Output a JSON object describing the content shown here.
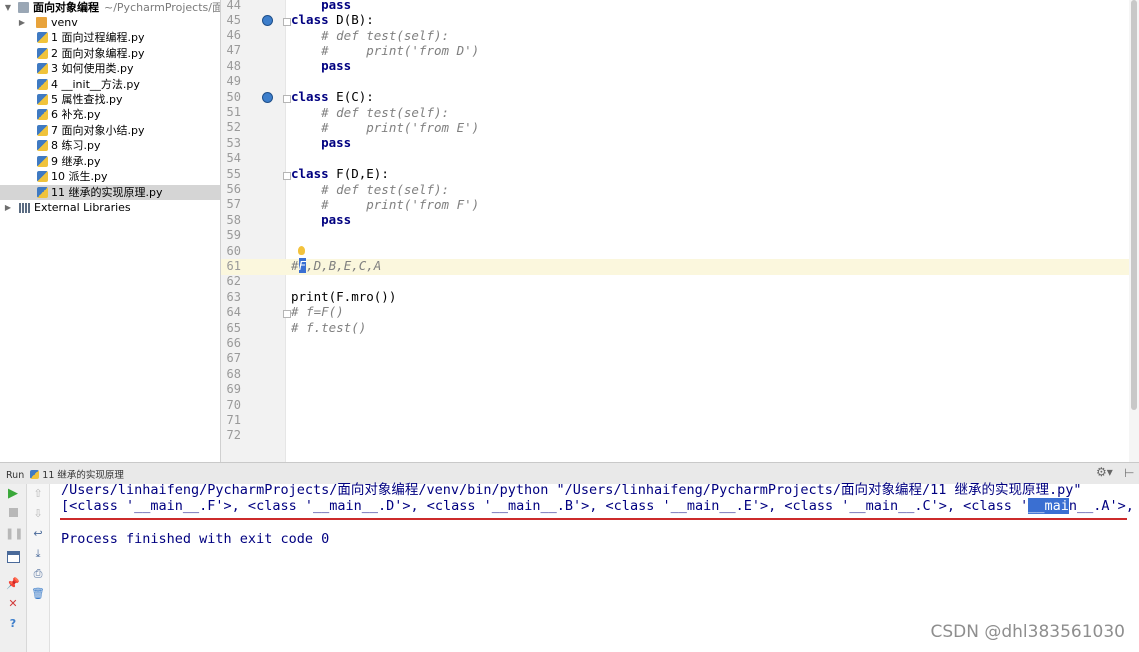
{
  "project": {
    "root_name": "面向对象编程",
    "root_path": "~/PycharmProjects/面向",
    "venv": "venv",
    "files": [
      "1 面向过程编程.py",
      "2 面向对象编程.py",
      "3 如何使用类.py",
      "4 __init__方法.py",
      "5 属性查找.py",
      "6 补充.py",
      "7 面向对象小结.py",
      "8 练习.py",
      "9 继承.py",
      "10 派生.py",
      "11 继承的实现原理.py"
    ],
    "selected_file_index": 10,
    "external_libraries": "External Libraries"
  },
  "editor": {
    "line_numbers": [
      "44",
      "45",
      "46",
      "47",
      "48",
      "49",
      "50",
      "51",
      "52",
      "53",
      "54",
      "55",
      "56",
      "57",
      "58",
      "59",
      "60",
      "61",
      "62",
      "63",
      "64",
      "65",
      "66",
      "67",
      "68",
      "69",
      "70",
      "71",
      "72"
    ],
    "code": {
      "l44": "    pass",
      "l45_kw": "class",
      "l45_rest": " D(B):",
      "l46": "    # def test(self):",
      "l47": "    #     print('from D')",
      "l48": "    pass",
      "l50_kw": "class",
      "l50_rest": " E(C):",
      "l51": "    # def test(self):",
      "l52": "    #     print('from E')",
      "l53": "    pass",
      "l55_kw": "class",
      "l55_rest": " F(D,E):",
      "l56": "    # def test(self):",
      "l57": "    #     print('from F')",
      "l58": "    pass",
      "l61_hash": "#",
      "l61_sel": "F",
      "l61_rest": ",D,B,E,C,A",
      "l63": "print(F.mro())",
      "l64": "# f=F()",
      "l65": "# f.test()"
    },
    "current_line": "61"
  },
  "run": {
    "tab_label": "Run",
    "config_name": "11 继承的实现原理",
    "command": "/Users/linhaifeng/PycharmProjects/面向对象编程/venv/bin/python \"/Users/linhaifeng/PycharmProjects/面向对象编程/11 继承的实现原理.py\"",
    "output_prefix": "[<class '__main__.F'>, <class '__main__.D'>, <class '__main__.B'>, <class '__main__.E'>, <class '__main__.C'>, <class '",
    "output_selected": "__mai",
    "output_suffix": "n__.A'>,",
    "finished": "Process finished with exit code 0"
  },
  "watermark": "CSDN @dhl383561030",
  "colors": {
    "keyword": "#000080",
    "comment": "#808080",
    "console_text": "#000080",
    "selection": "#3a6fd2",
    "current_line": "#fbf7dd",
    "error_underline": "#cc2b2b"
  }
}
